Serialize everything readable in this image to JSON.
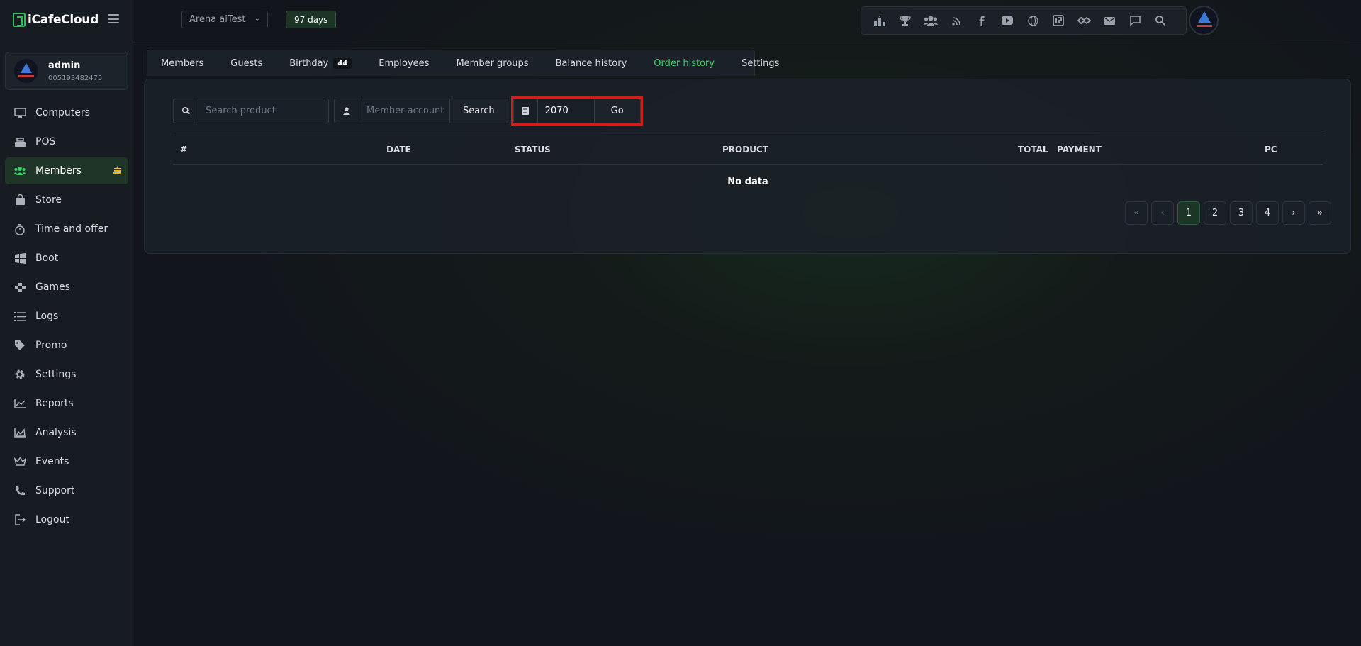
{
  "app": {
    "name": "iCafeCloud"
  },
  "user": {
    "name": "admin",
    "id": "005193482475"
  },
  "sidebar": {
    "items": [
      {
        "label": "Computers",
        "icon": "monitor-icon"
      },
      {
        "label": "POS",
        "icon": "cash-register-icon"
      },
      {
        "label": "Members",
        "icon": "users-icon",
        "active": true
      },
      {
        "label": "Store",
        "icon": "shopping-bag-icon"
      },
      {
        "label": "Time and offer",
        "icon": "stopwatch-icon"
      },
      {
        "label": "Boot",
        "icon": "windows-icon"
      },
      {
        "label": "Games",
        "icon": "gamepad-icon"
      },
      {
        "label": "Logs",
        "icon": "list-icon"
      },
      {
        "label": "Promo",
        "icon": "tag-icon"
      },
      {
        "label": "Settings",
        "icon": "gear-icon"
      },
      {
        "label": "Reports",
        "icon": "line-chart-icon"
      },
      {
        "label": "Analysis",
        "icon": "area-chart-icon"
      },
      {
        "label": "Events",
        "icon": "crown-icon"
      },
      {
        "label": "Support",
        "icon": "phone-icon"
      },
      {
        "label": "Logout",
        "icon": "logout-icon"
      }
    ]
  },
  "topbar": {
    "arena": "Arena aiTest",
    "days": "97 days",
    "icons": [
      "leaderboard-icon",
      "trophy-icon",
      "group-icon",
      "rss-icon",
      "facebook-icon",
      "youtube-icon",
      "globe-icon",
      "icafe-logo-icon",
      "handshake-icon",
      "mail-icon",
      "chat-icon",
      "search-icon"
    ]
  },
  "tabs": [
    {
      "label": "Members"
    },
    {
      "label": "Guests"
    },
    {
      "label": "Birthday",
      "count": "44"
    },
    {
      "label": "Employees"
    },
    {
      "label": "Member groups"
    },
    {
      "label": "Balance history"
    },
    {
      "label": "Order history",
      "active": true
    },
    {
      "label": "Settings"
    }
  ],
  "filters": {
    "product_placeholder": "Search product",
    "member_placeholder": "Member account",
    "search_label": "Search",
    "page_value": "2070",
    "go_label": "Go"
  },
  "table": {
    "columns": [
      "#",
      "DATE",
      "STATUS",
      "PRODUCT",
      "TOTAL",
      "PAYMENT",
      "PC"
    ],
    "empty": "No data"
  },
  "pagination": {
    "first": "«",
    "prev": "‹",
    "pages": [
      "1",
      "2",
      "3",
      "4"
    ],
    "next": "›",
    "last": "»",
    "current": "1"
  },
  "colors": {
    "accent": "#3ccf66",
    "highlight": "#d21d1d",
    "badge": "#e8b923"
  }
}
